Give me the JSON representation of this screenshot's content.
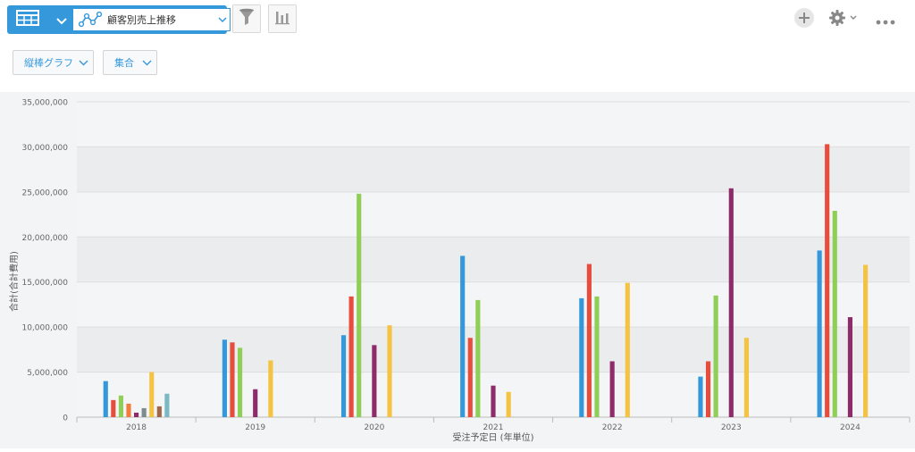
{
  "toolbar": {
    "graph_name": "顧客別売上推移",
    "icons": [
      "table-icon",
      "chevron-down-icon",
      "line-graph-icon",
      "filter-icon",
      "bar-chart-icon",
      "plus-icon",
      "gear-icon",
      "more-icon"
    ]
  },
  "options": {
    "chart_type_label": "縦棒グラフ",
    "aggregation_label": "集合"
  },
  "chart_data": {
    "type": "bar",
    "xlabel": "受注予定日 (年単位)",
    "ylabel": "合計(合計費用)",
    "ylim": [
      0,
      35000000
    ],
    "yticks": [
      {
        "value": 0,
        "label": "0"
      },
      {
        "value": 5000000,
        "label": "5,000,000"
      },
      {
        "value": 10000000,
        "label": "10,000,000"
      },
      {
        "value": 15000000,
        "label": "15,000,000"
      },
      {
        "value": 20000000,
        "label": "20,000,000"
      },
      {
        "value": 25000000,
        "label": "25,000,000"
      },
      {
        "value": 30000000,
        "label": "30,000,000"
      },
      {
        "value": 35000000,
        "label": "35,000,000"
      }
    ],
    "categories": [
      "2018",
      "2019",
      "2020",
      "2021",
      "2022",
      "2023",
      "2024"
    ],
    "series": [
      {
        "color": "#3498db",
        "values": [
          4000000,
          8600000,
          9100000,
          17900000,
          13200000,
          4500000,
          18500000
        ]
      },
      {
        "color": "#e74c3c",
        "values": [
          1900000,
          8300000,
          13400000,
          8800000,
          17000000,
          6200000,
          30300000
        ]
      },
      {
        "color": "#8fcf57",
        "values": [
          2400000,
          7700000,
          24800000,
          13000000,
          13400000,
          13500000,
          22900000
        ]
      },
      {
        "color": "#f47c3c",
        "values": [
          1500000,
          null,
          null,
          null,
          null,
          null,
          null
        ]
      },
      {
        "color": "#8e2c6b",
        "values": [
          500000,
          3100000,
          8000000,
          3500000,
          6200000,
          25400000,
          11100000
        ]
      },
      {
        "color": "#7f8c8d",
        "values": [
          1000000,
          null,
          null,
          null,
          null,
          null,
          null
        ]
      },
      {
        "color": "#f5c342",
        "values": [
          5000000,
          6300000,
          10200000,
          2800000,
          14900000,
          8800000,
          16900000
        ]
      },
      {
        "color": "#a0674b",
        "values": [
          1200000,
          null,
          null,
          null,
          null,
          null,
          null
        ]
      },
      {
        "color": "#7ab8c4",
        "values": [
          2600000,
          null,
          null,
          null,
          null,
          null,
          null
        ]
      }
    ],
    "grid": true,
    "legend": "none"
  }
}
